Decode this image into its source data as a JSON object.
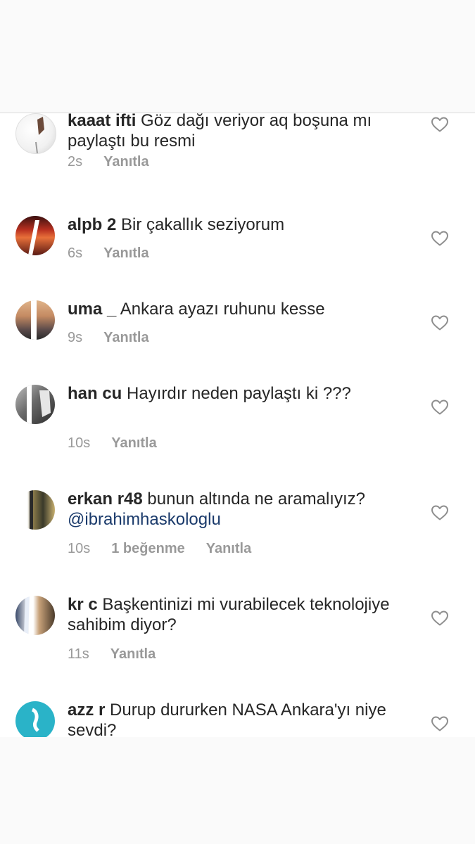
{
  "colors": {
    "mention": "#1a3a6b",
    "meta": "#999999",
    "text": "#262626",
    "divider": "#dbdbdb"
  },
  "comments": [
    {
      "username": "kaaat ifti",
      "text": "Göz dağı veriyor aq boşuna mı paylaştı bu resmi",
      "time": "2s",
      "likes": "",
      "reply": "Yanıtla",
      "mention": ""
    },
    {
      "username": "alpb 2",
      "text": "Bir çakallık seziyorum",
      "time": "6s",
      "likes": "",
      "reply": "Yanıtla",
      "mention": ""
    },
    {
      "username": "uma _",
      "text": "Ankara ayazı ruhunu kesse",
      "time": "9s",
      "likes": "",
      "reply": "Yanıtla",
      "mention": ""
    },
    {
      "username": "han cu",
      "text": "Hayırdır neden paylaştı ki ???",
      "time": "10s",
      "likes": "",
      "reply": "Yanıtla",
      "mention": ""
    },
    {
      "username": "erkan r48",
      "text": "bunun altında ne aramalıyız?",
      "time": "10s",
      "likes": "1 beğenme",
      "reply": "Yanıtla",
      "mention": "@ibrahimhaskologlu"
    },
    {
      "username": "kr c",
      "text": "Başkentinizi mi vurabilecek teknolojiye sahibim diyor?",
      "time": "11s",
      "likes": "",
      "reply": "Yanıtla",
      "mention": ""
    },
    {
      "username": "azz r",
      "text": "Durup dururken NASA Ankara'yı niye sevdi?",
      "time": "",
      "likes": "",
      "reply": "",
      "mention": ""
    }
  ]
}
